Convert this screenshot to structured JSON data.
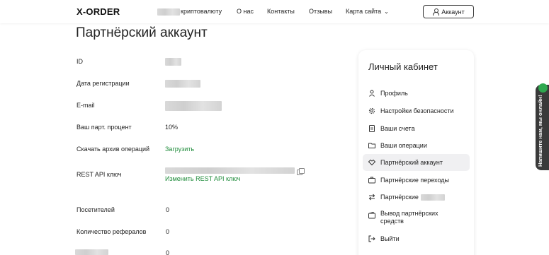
{
  "header": {
    "logo": "X-ORDER",
    "nav": {
      "buy_crypto": "криптовалюту",
      "about": "О нас",
      "contacts": "Контакты",
      "reviews": "Отзывы",
      "sitemap": "Карта сайта"
    },
    "account_button": "Аккаунт"
  },
  "page": {
    "title": "Партнёрский аккаунт",
    "rows": {
      "id": {
        "label": "ID",
        "value": ""
      },
      "reg_date": {
        "label": "Дата регистрации",
        "value": ""
      },
      "email": {
        "label": "E-mail",
        "value": ""
      },
      "percent": {
        "label": "Ваш парт. процент",
        "value": "10%"
      },
      "archive": {
        "label": "Скачать архив операций",
        "value": "Загрузить"
      },
      "api_key": {
        "label": "REST API ключ",
        "value": "",
        "change_link": "Изменить REST API ключ"
      },
      "visitors": {
        "label": "Посетителей",
        "value": "0"
      },
      "referrals": {
        "label": "Количество рефералов",
        "value": "0"
      },
      "hidden_row": {
        "label": "",
        "value": "0"
      }
    }
  },
  "sidebar": {
    "title": "Личный кабинет",
    "items": [
      {
        "label": "Профиль",
        "icon": "user-icon"
      },
      {
        "label": "Настройки безопасности",
        "icon": "gear-icon"
      },
      {
        "label": "Ваши счета",
        "icon": "document-icon"
      },
      {
        "label": "Ваши операции",
        "icon": "folder-icon"
      },
      {
        "label": "Партнёрский аккаунт",
        "icon": "handshake-icon",
        "active": true
      },
      {
        "label": "Партнёрские переходы",
        "icon": "briefcase-icon"
      },
      {
        "label": "Партнёрские",
        "icon": "exchange-icon"
      },
      {
        "label": "Вывод партнёрских средств",
        "icon": "wallet-icon"
      },
      {
        "label": "Выйти",
        "icon": "logout-icon"
      }
    ]
  },
  "feedback": {
    "label": "Напишите нам, мы онлайн!"
  }
}
